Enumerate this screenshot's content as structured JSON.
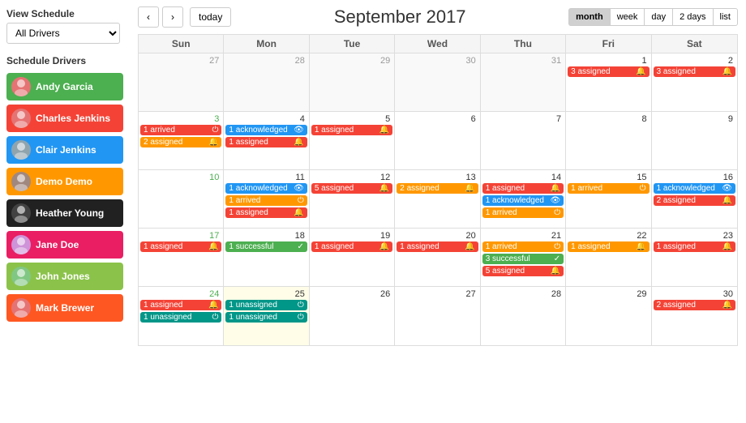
{
  "sidebar": {
    "view_schedule_label": "View Schedule",
    "driver_select": {
      "value": "All Drivers",
      "options": [
        "All Drivers"
      ]
    },
    "schedule_drivers_label": "Schedule Drivers",
    "drivers": [
      {
        "name": "Andy Garcia",
        "color": "#4caf50",
        "avatar_color": "#e57373"
      },
      {
        "name": "Charles Jenkins",
        "color": "#f44336",
        "avatar_color": "#e57373"
      },
      {
        "name": "Clair Jenkins",
        "color": "#2196f3",
        "avatar_color": "#90a4ae"
      },
      {
        "name": "Demo Demo",
        "color": "#ff9800",
        "avatar_color": "#a1887f"
      },
      {
        "name": "Heather Young",
        "color": "#212121",
        "avatar_color": "#424242"
      },
      {
        "name": "Jane Doe",
        "color": "#e91e63",
        "avatar_color": "#ce93d8"
      },
      {
        "name": "John Jones",
        "color": "#8bc34a",
        "avatar_color": "#81c784"
      },
      {
        "name": "Mark Brewer",
        "color": "#ff5722",
        "avatar_color": "#e57373"
      }
    ]
  },
  "calendar": {
    "title": "September 2017",
    "nav": {
      "prev": "‹",
      "next": "›",
      "today": "today"
    },
    "view_buttons": [
      "month",
      "week",
      "day",
      "2 days",
      "list"
    ],
    "active_view": "month",
    "day_headers": [
      "Sun",
      "Mon",
      "Tue",
      "Wed",
      "Thu",
      "Fri",
      "Sat"
    ],
    "weeks": [
      {
        "days": [
          {
            "num": "27",
            "other": true,
            "events": []
          },
          {
            "num": "28",
            "other": true,
            "events": []
          },
          {
            "num": "29",
            "other": true,
            "events": []
          },
          {
            "num": "30",
            "other": true,
            "events": []
          },
          {
            "num": "31",
            "other": true,
            "events": []
          },
          {
            "num": "1",
            "events": [
              {
                "label": "3 assigned",
                "icon": "🔔",
                "color": "ev-red"
              }
            ]
          },
          {
            "num": "2",
            "events": [
              {
                "label": "3 assigned",
                "icon": "🔔",
                "color": "ev-red"
              }
            ]
          }
        ]
      },
      {
        "days": [
          {
            "num": "3",
            "events": [
              {
                "label": "1 arrived",
                "icon": "⏻",
                "color": "ev-red"
              },
              {
                "label": "2 assigned",
                "icon": "🔔",
                "color": "ev-orange"
              }
            ]
          },
          {
            "num": "4",
            "events": [
              {
                "label": "1 acknowledged",
                "icon": "👁",
                "color": "ev-blue"
              },
              {
                "label": "1 assigned",
                "icon": "🔔",
                "color": "ev-red"
              }
            ]
          },
          {
            "num": "5",
            "events": [
              {
                "label": "1 assigned",
                "icon": "🔔",
                "color": "ev-red"
              }
            ]
          },
          {
            "num": "6",
            "events": []
          },
          {
            "num": "7",
            "events": []
          },
          {
            "num": "8",
            "events": []
          },
          {
            "num": "9",
            "events": []
          }
        ]
      },
      {
        "days": [
          {
            "num": "10",
            "events": []
          },
          {
            "num": "11",
            "events": [
              {
                "label": "1 acknowledged",
                "icon": "👁",
                "color": "ev-blue"
              },
              {
                "label": "1 arrived",
                "icon": "⏻",
                "color": "ev-orange"
              },
              {
                "label": "1 assigned",
                "icon": "🔔",
                "color": "ev-red"
              }
            ]
          },
          {
            "num": "12",
            "events": [
              {
                "label": "5 assigned",
                "icon": "🔔",
                "color": "ev-red"
              }
            ]
          },
          {
            "num": "13",
            "events": [
              {
                "label": "2 assigned",
                "icon": "🔔",
                "color": "ev-orange"
              }
            ]
          },
          {
            "num": "14",
            "events": [
              {
                "label": "1 assigned",
                "icon": "🔔",
                "color": "ev-red"
              },
              {
                "label": "1 acknowledged",
                "icon": "👁",
                "color": "ev-blue"
              },
              {
                "label": "1 arrived",
                "icon": "⏻",
                "color": "ev-orange"
              }
            ]
          },
          {
            "num": "15",
            "events": [
              {
                "label": "1 arrived",
                "icon": "⏻",
                "color": "ev-orange"
              }
            ]
          },
          {
            "num": "16",
            "events": [
              {
                "label": "1 acknowledged",
                "icon": "👁",
                "color": "ev-blue"
              },
              {
                "label": "2 assigned",
                "icon": "🔔",
                "color": "ev-red"
              }
            ]
          }
        ]
      },
      {
        "days": [
          {
            "num": "17",
            "events": [
              {
                "label": "1 assigned",
                "icon": "🔔",
                "color": "ev-red"
              }
            ]
          },
          {
            "num": "18",
            "events": [
              {
                "label": "1 successful",
                "icon": "✓",
                "color": "ev-green"
              }
            ]
          },
          {
            "num": "19",
            "events": [
              {
                "label": "1 assigned",
                "icon": "🔔",
                "color": "ev-red"
              }
            ]
          },
          {
            "num": "20",
            "events": [
              {
                "label": "1 assigned",
                "icon": "🔔",
                "color": "ev-red"
              }
            ]
          },
          {
            "num": "21",
            "events": [
              {
                "label": "1 arrived",
                "icon": "⏻",
                "color": "ev-orange"
              },
              {
                "label": "3 successful",
                "icon": "✓",
                "color": "ev-green"
              },
              {
                "label": "5 assigned",
                "icon": "🔔",
                "color": "ev-red"
              }
            ]
          },
          {
            "num": "22",
            "events": [
              {
                "label": "1 assigned",
                "icon": "🔔",
                "color": "ev-orange"
              }
            ]
          },
          {
            "num": "23",
            "events": [
              {
                "label": "1 assigned",
                "icon": "🔔",
                "color": "ev-red"
              }
            ]
          }
        ]
      },
      {
        "days": [
          {
            "num": "24",
            "events": [
              {
                "label": "1 assigned",
                "icon": "🔔",
                "color": "ev-red"
              },
              {
                "label": "1 unassigned",
                "icon": "⏻",
                "color": "ev-teal"
              }
            ]
          },
          {
            "num": "25",
            "highlight": true,
            "events": [
              {
                "label": "1 unassigned",
                "icon": "⏻",
                "color": "ev-teal"
              },
              {
                "label": "1 unassigned",
                "icon": "⏻",
                "color": "ev-teal"
              }
            ]
          },
          {
            "num": "26",
            "events": []
          },
          {
            "num": "27",
            "events": []
          },
          {
            "num": "28",
            "events": []
          },
          {
            "num": "29",
            "events": []
          },
          {
            "num": "30",
            "events": [
              {
                "label": "2 assigned",
                "icon": "🔔",
                "color": "ev-red"
              }
            ]
          }
        ]
      }
    ]
  }
}
